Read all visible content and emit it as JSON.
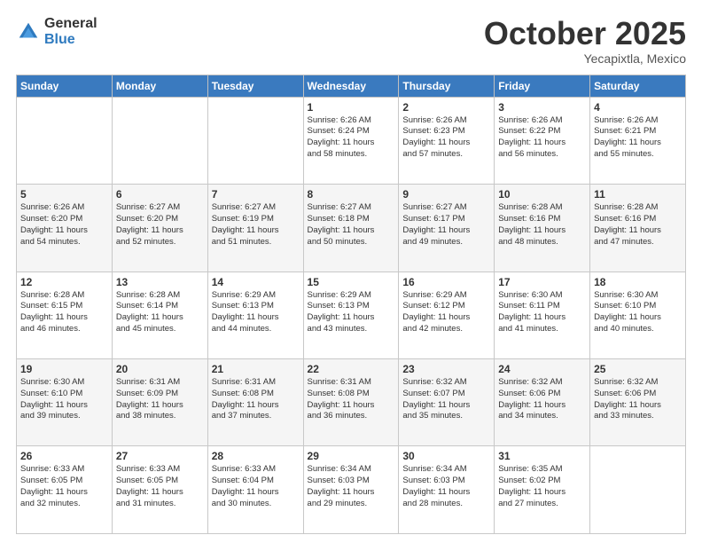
{
  "logo": {
    "general": "General",
    "blue": "Blue"
  },
  "header": {
    "month": "October 2025",
    "location": "Yecapixtla, Mexico"
  },
  "days_of_week": [
    "Sunday",
    "Monday",
    "Tuesday",
    "Wednesday",
    "Thursday",
    "Friday",
    "Saturday"
  ],
  "weeks": [
    [
      {
        "day": "",
        "info": ""
      },
      {
        "day": "",
        "info": ""
      },
      {
        "day": "",
        "info": ""
      },
      {
        "day": "1",
        "info": "Sunrise: 6:26 AM\nSunset: 6:24 PM\nDaylight: 11 hours\nand 58 minutes."
      },
      {
        "day": "2",
        "info": "Sunrise: 6:26 AM\nSunset: 6:23 PM\nDaylight: 11 hours\nand 57 minutes."
      },
      {
        "day": "3",
        "info": "Sunrise: 6:26 AM\nSunset: 6:22 PM\nDaylight: 11 hours\nand 56 minutes."
      },
      {
        "day": "4",
        "info": "Sunrise: 6:26 AM\nSunset: 6:21 PM\nDaylight: 11 hours\nand 55 minutes."
      }
    ],
    [
      {
        "day": "5",
        "info": "Sunrise: 6:26 AM\nSunset: 6:20 PM\nDaylight: 11 hours\nand 54 minutes."
      },
      {
        "day": "6",
        "info": "Sunrise: 6:27 AM\nSunset: 6:20 PM\nDaylight: 11 hours\nand 52 minutes."
      },
      {
        "day": "7",
        "info": "Sunrise: 6:27 AM\nSunset: 6:19 PM\nDaylight: 11 hours\nand 51 minutes."
      },
      {
        "day": "8",
        "info": "Sunrise: 6:27 AM\nSunset: 6:18 PM\nDaylight: 11 hours\nand 50 minutes."
      },
      {
        "day": "9",
        "info": "Sunrise: 6:27 AM\nSunset: 6:17 PM\nDaylight: 11 hours\nand 49 minutes."
      },
      {
        "day": "10",
        "info": "Sunrise: 6:28 AM\nSunset: 6:16 PM\nDaylight: 11 hours\nand 48 minutes."
      },
      {
        "day": "11",
        "info": "Sunrise: 6:28 AM\nSunset: 6:16 PM\nDaylight: 11 hours\nand 47 minutes."
      }
    ],
    [
      {
        "day": "12",
        "info": "Sunrise: 6:28 AM\nSunset: 6:15 PM\nDaylight: 11 hours\nand 46 minutes."
      },
      {
        "day": "13",
        "info": "Sunrise: 6:28 AM\nSunset: 6:14 PM\nDaylight: 11 hours\nand 45 minutes."
      },
      {
        "day": "14",
        "info": "Sunrise: 6:29 AM\nSunset: 6:13 PM\nDaylight: 11 hours\nand 44 minutes."
      },
      {
        "day": "15",
        "info": "Sunrise: 6:29 AM\nSunset: 6:13 PM\nDaylight: 11 hours\nand 43 minutes."
      },
      {
        "day": "16",
        "info": "Sunrise: 6:29 AM\nSunset: 6:12 PM\nDaylight: 11 hours\nand 42 minutes."
      },
      {
        "day": "17",
        "info": "Sunrise: 6:30 AM\nSunset: 6:11 PM\nDaylight: 11 hours\nand 41 minutes."
      },
      {
        "day": "18",
        "info": "Sunrise: 6:30 AM\nSunset: 6:10 PM\nDaylight: 11 hours\nand 40 minutes."
      }
    ],
    [
      {
        "day": "19",
        "info": "Sunrise: 6:30 AM\nSunset: 6:10 PM\nDaylight: 11 hours\nand 39 minutes."
      },
      {
        "day": "20",
        "info": "Sunrise: 6:31 AM\nSunset: 6:09 PM\nDaylight: 11 hours\nand 38 minutes."
      },
      {
        "day": "21",
        "info": "Sunrise: 6:31 AM\nSunset: 6:08 PM\nDaylight: 11 hours\nand 37 minutes."
      },
      {
        "day": "22",
        "info": "Sunrise: 6:31 AM\nSunset: 6:08 PM\nDaylight: 11 hours\nand 36 minutes."
      },
      {
        "day": "23",
        "info": "Sunrise: 6:32 AM\nSunset: 6:07 PM\nDaylight: 11 hours\nand 35 minutes."
      },
      {
        "day": "24",
        "info": "Sunrise: 6:32 AM\nSunset: 6:06 PM\nDaylight: 11 hours\nand 34 minutes."
      },
      {
        "day": "25",
        "info": "Sunrise: 6:32 AM\nSunset: 6:06 PM\nDaylight: 11 hours\nand 33 minutes."
      }
    ],
    [
      {
        "day": "26",
        "info": "Sunrise: 6:33 AM\nSunset: 6:05 PM\nDaylight: 11 hours\nand 32 minutes."
      },
      {
        "day": "27",
        "info": "Sunrise: 6:33 AM\nSunset: 6:05 PM\nDaylight: 11 hours\nand 31 minutes."
      },
      {
        "day": "28",
        "info": "Sunrise: 6:33 AM\nSunset: 6:04 PM\nDaylight: 11 hours\nand 30 minutes."
      },
      {
        "day": "29",
        "info": "Sunrise: 6:34 AM\nSunset: 6:03 PM\nDaylight: 11 hours\nand 29 minutes."
      },
      {
        "day": "30",
        "info": "Sunrise: 6:34 AM\nSunset: 6:03 PM\nDaylight: 11 hours\nand 28 minutes."
      },
      {
        "day": "31",
        "info": "Sunrise: 6:35 AM\nSunset: 6:02 PM\nDaylight: 11 hours\nand 27 minutes."
      },
      {
        "day": "",
        "info": ""
      }
    ]
  ]
}
